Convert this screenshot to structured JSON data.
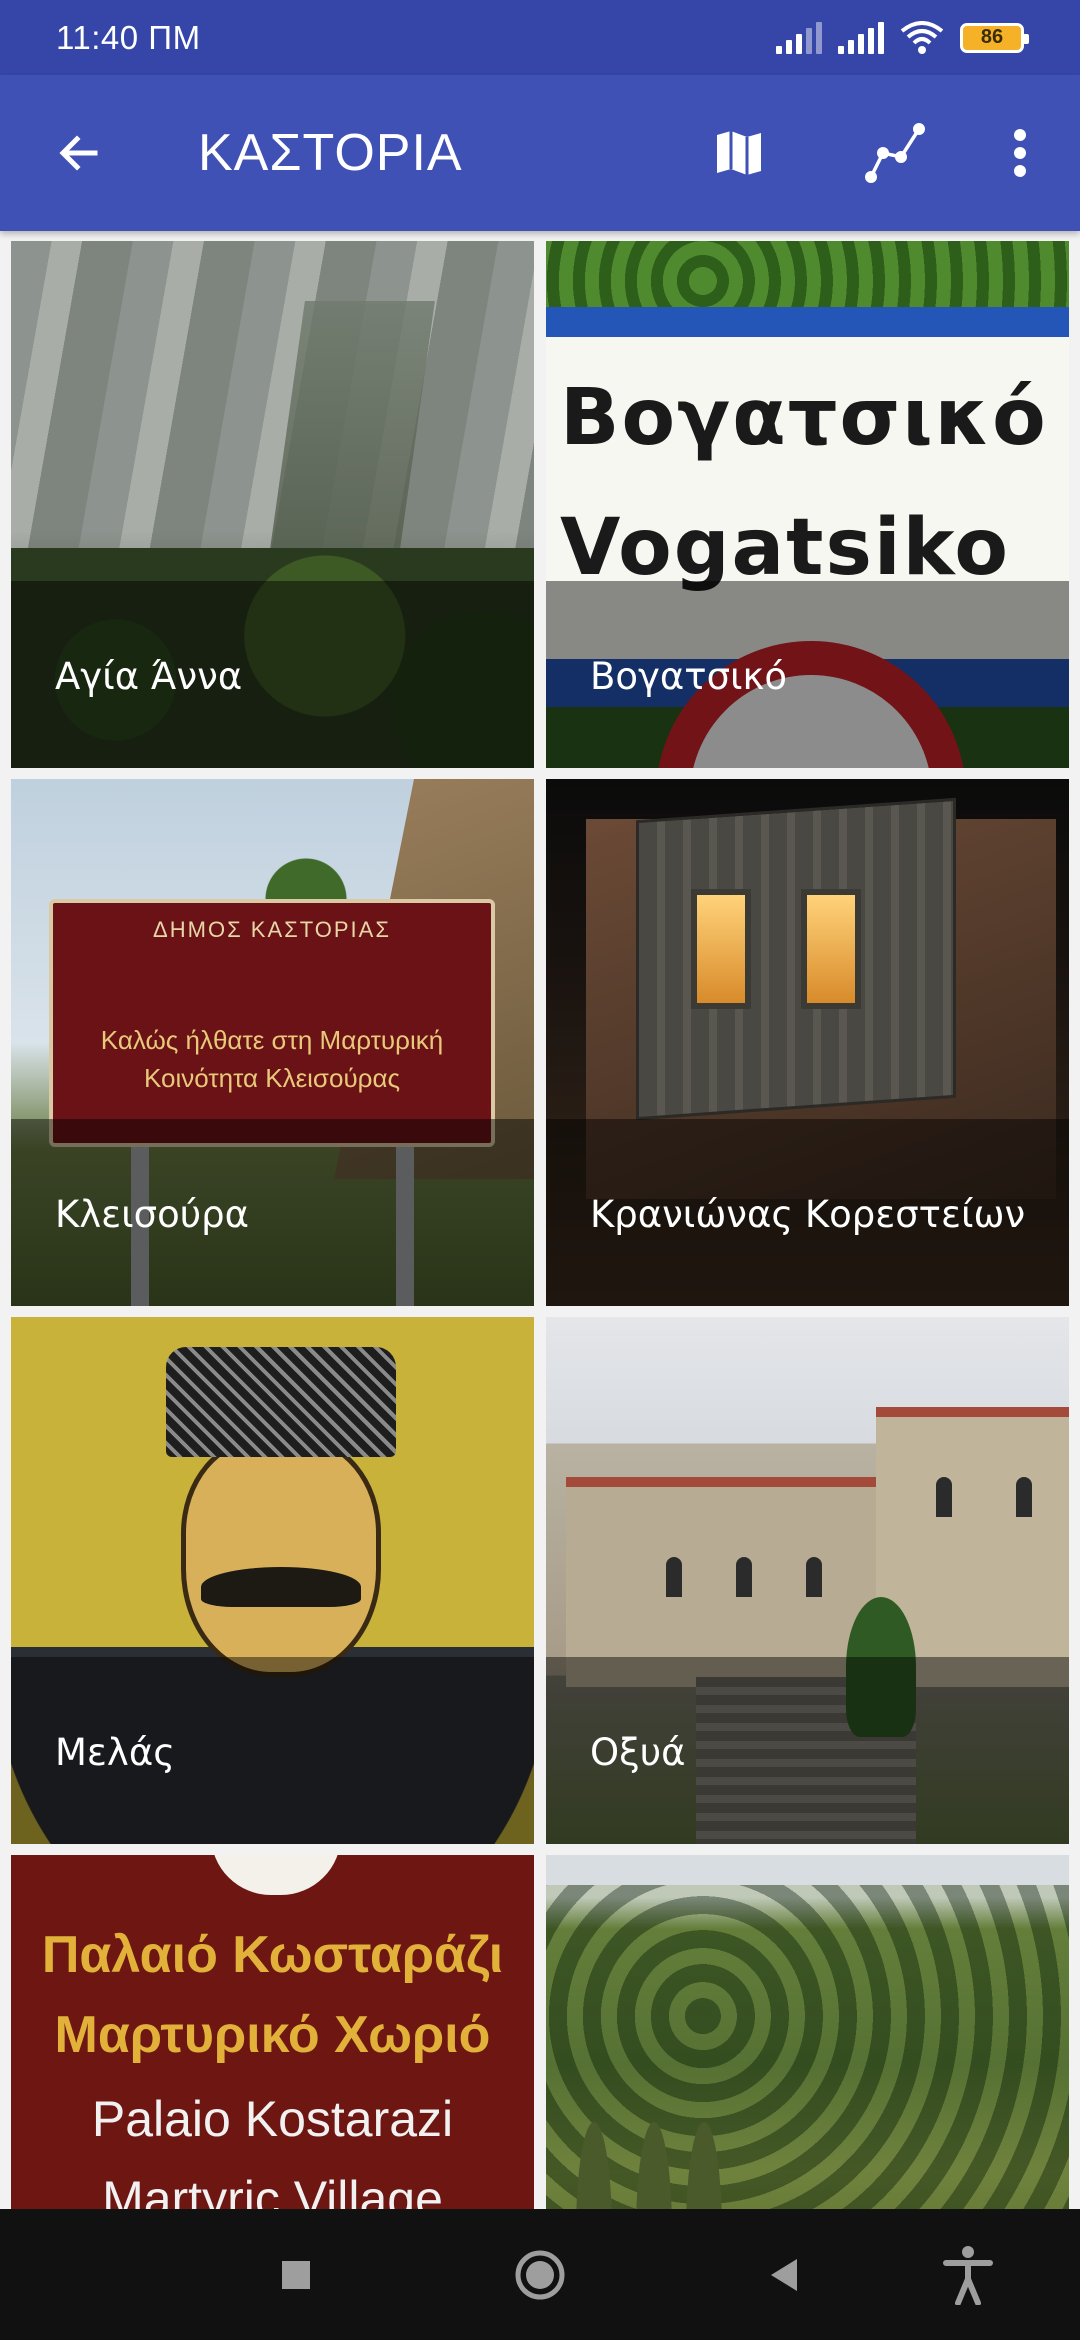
{
  "status_bar": {
    "time": "11:40 ΠΜ",
    "battery": "86"
  },
  "app_bar": {
    "title": "ΚΑΣΤΟΡΙΑ",
    "icons": {
      "back": "arrow-back-icon",
      "map": "map-icon",
      "route": "route-icon",
      "more": "more-vert-icon"
    }
  },
  "places": [
    {
      "name": "Αγία Άννα"
    },
    {
      "name": "Βογατσικό",
      "sign_line1": "Βογατσικό",
      "sign_line2": "Vogatsiko"
    },
    {
      "name": "Κλεισούρα",
      "sign_line1": "ΔΗΜΟΣ ΚΑΣΤΟΡΙΑΣ",
      "sign_line2": "Καλώς ήλθατε στη Μαρτυρική",
      "sign_line3": "Κοινότητα Κλεισούρας"
    },
    {
      "name": "Κρανιώνας Κορεστείων"
    },
    {
      "name": "Μελάς"
    },
    {
      "name": "Οξυά"
    },
    {
      "name": "",
      "sign_line1": "Παλαιό Κωσταράζι",
      "sign_line2": "Μαρτυρικό Χωριό",
      "sign_line3": "Palaio Kostarazi",
      "sign_line4": "Martyric Village"
    },
    {
      "name": ""
    }
  ],
  "colors": {
    "status_bar": "#3546a8",
    "app_bar": "#3f51b5",
    "nav_bar": "#111111"
  },
  "nav_bar": {
    "icons": [
      "recent-apps-icon",
      "home-icon",
      "back-icon",
      "accessibility-icon"
    ]
  }
}
